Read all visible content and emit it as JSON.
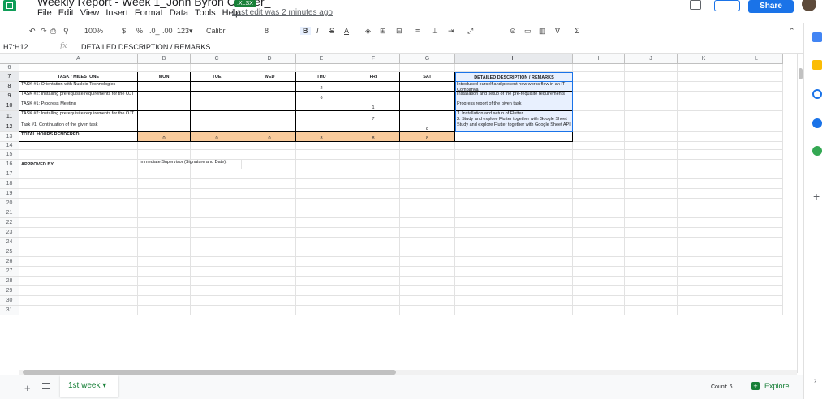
{
  "app": {
    "title": "Weekly Report - Week 1_John Byron Cander_",
    "badge": ".XLSX",
    "last_edit": "Last edit was 2 minutes ago",
    "share_label": "Share",
    "menus": [
      "File",
      "Edit",
      "View",
      "Insert",
      "Format",
      "Data",
      "Tools",
      "Help"
    ]
  },
  "toolbar": {
    "zoom": "100%",
    "currency": "$",
    "percent": "%",
    "dec_less": ".0_",
    "dec_more": ".00",
    "format": "123▾",
    "font": "Calibri",
    "size": "8"
  },
  "formula": {
    "namebox": "H7:H12",
    "content": "DETAILED DESCRIPTION / REMARKS"
  },
  "columns": [
    "A",
    "B",
    "C",
    "D",
    "E",
    "F",
    "G",
    "H",
    "I",
    "J",
    "K",
    "L"
  ],
  "rows": [
    "6",
    "7",
    "8",
    "9",
    "10",
    "11",
    "12",
    "13",
    "14",
    "15",
    "16",
    "17",
    "18",
    "19",
    "20",
    "21",
    "22",
    "23",
    "24",
    "25",
    "26",
    "27",
    "28",
    "29",
    "30",
    "31"
  ],
  "table": {
    "headers": [
      "TASK / MILESTONE",
      "MON",
      "TUE",
      "WED",
      "THU",
      "FRI",
      "SAT",
      "DETAILED DESCRIPTION / REMARKS"
    ],
    "r8": {
      "a": "TASK #1: Orientation with Nucleio Technologies",
      "e": "2",
      "h": "Introduced ourself and present how works flow in an IT Companya"
    },
    "r9": {
      "a": "TASK #2: Installing prerequisite requirements for the OJT",
      "e": "6",
      "h": "Installation and setup of the pre-requisite requirements"
    },
    "r10": {
      "a": "TASK #1: Progress Meeting",
      "f": "1",
      "h": "Progress report of the given task"
    },
    "r11": {
      "a": "TASK #2: Installing prerequisite requirements for the OJT",
      "f": "7",
      "h": "1. Installation and setup of Flutter\n2. Study and explore Flutter together with Google Sheet API"
    },
    "r12": {
      "a": "Task #1: Continuation of the given task",
      "g": "8",
      "h": "Study and explore Flutter together with Google Sheet API"
    },
    "r13": {
      "a": "TOTAL HOURS RENDERED:",
      "b": "0",
      "c": "0",
      "d": "0",
      "e": "8",
      "f": "8",
      "g": "8"
    },
    "r16": {
      "a": "APPROVED BY:",
      "b": "Immediate Supervisor (Signature and Date):"
    }
  },
  "sheet": {
    "tab": "1st week",
    "count": "Count: 6",
    "explore": "Explore"
  },
  "colors": {
    "accent": "#1a73e8",
    "green": "#188038",
    "orange": "#f9cb9c",
    "selection": "#e8f0fe"
  }
}
